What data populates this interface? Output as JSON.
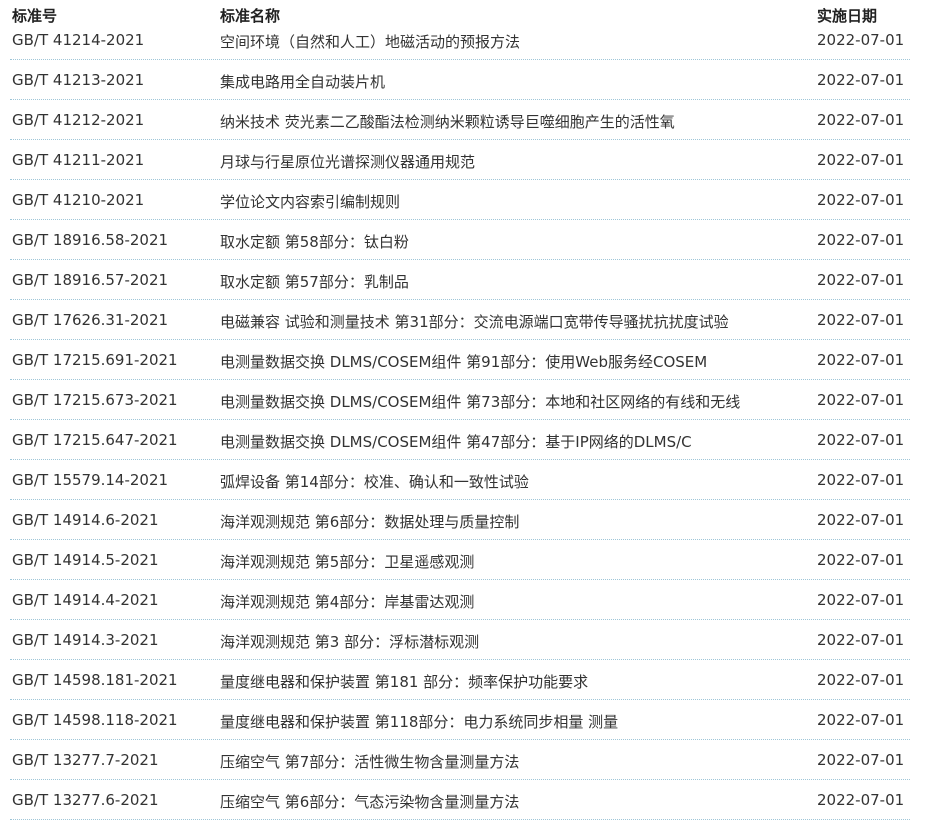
{
  "table": {
    "headers": {
      "code": "标准号",
      "name": "标准名称",
      "date": "实施日期"
    },
    "rows": [
      {
        "code": "GB/T 41214-2021",
        "name": "空间环境（自然和人工）地磁活动的预报方法",
        "date": "2022-07-01"
      },
      {
        "code": "GB/T 41213-2021",
        "name": "集成电路用全自动装片机",
        "date": "2022-07-01"
      },
      {
        "code": "GB/T 41212-2021",
        "name": "纳米技术 荧光素二乙酸酯法检测纳米颗粒诱导巨噬细胞产生的活性氧",
        "date": "2022-07-01"
      },
      {
        "code": "GB/T 41211-2021",
        "name": "月球与行星原位光谱探测仪器通用规范",
        "date": "2022-07-01"
      },
      {
        "code": "GB/T 41210-2021",
        "name": "学位论文内容索引编制规则",
        "date": "2022-07-01"
      },
      {
        "code": "GB/T 18916.58-2021",
        "name": "取水定额 第58部分：钛白粉",
        "date": "2022-07-01"
      },
      {
        "code": "GB/T 18916.57-2021",
        "name": "取水定额 第57部分：乳制品",
        "date": "2022-07-01"
      },
      {
        "code": "GB/T 17626.31-2021",
        "name": "电磁兼容 试验和测量技术 第31部分：交流电源端口宽带传导骚扰抗扰度试验",
        "date": "2022-07-01"
      },
      {
        "code": "GB/T 17215.691-2021",
        "name": "电测量数据交换 DLMS/COSEM组件 第91部分：使用Web服务经COSEM",
        "date": "2022-07-01"
      },
      {
        "code": "GB/T 17215.673-2021",
        "name": "电测量数据交换 DLMS/COSEM组件 第73部分：本地和社区网络的有线和无线",
        "date": "2022-07-01"
      },
      {
        "code": "GB/T 17215.647-2021",
        "name": "电测量数据交换 DLMS/COSEM组件 第47部分：基于IP网络的DLMS/C",
        "date": "2022-07-01"
      },
      {
        "code": "GB/T 15579.14-2021",
        "name": "弧焊设备 第14部分：校准、确认和一致性试验",
        "date": "2022-07-01"
      },
      {
        "code": "GB/T 14914.6-2021",
        "name": "海洋观测规范 第6部分：数据处理与质量控制",
        "date": "2022-07-01"
      },
      {
        "code": "GB/T 14914.5-2021",
        "name": "海洋观测规范 第5部分：卫星遥感观测",
        "date": "2022-07-01"
      },
      {
        "code": "GB/T 14914.4-2021",
        "name": "海洋观测规范 第4部分：岸基雷达观测",
        "date": "2022-07-01"
      },
      {
        "code": "GB/T 14914.3-2021",
        "name": "海洋观测规范 第3 部分：浮标潜标观测",
        "date": "2022-07-01"
      },
      {
        "code": "GB/T 14598.181-2021",
        "name": "量度继电器和保护装置 第181 部分：频率保护功能要求",
        "date": "2022-07-01"
      },
      {
        "code": "GB/T 14598.118-2021",
        "name": "量度继电器和保护装置 第118部分：电力系统同步相量 测量",
        "date": "2022-07-01"
      },
      {
        "code": "GB/T 13277.7-2021",
        "name": "压缩空气 第7部分：活性微生物含量测量方法",
        "date": "2022-07-01"
      },
      {
        "code": "GB/T 13277.6-2021",
        "name": "压缩空气 第6部分：气态污染物含量测量方法",
        "date": "2022-07-01"
      }
    ]
  }
}
